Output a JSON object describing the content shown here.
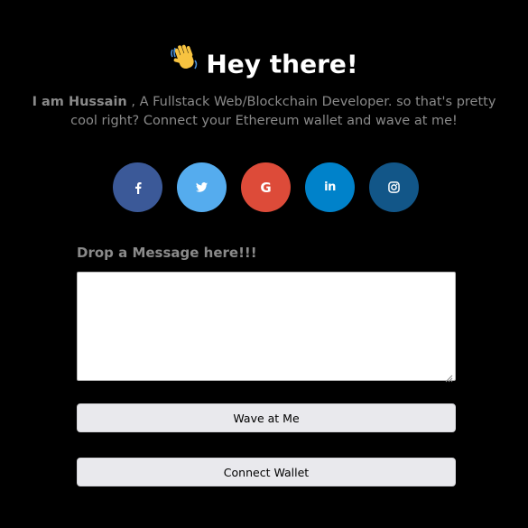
{
  "header": {
    "emoji_icon": "waving-hand-icon",
    "title": "Hey there!"
  },
  "bio": {
    "name": "I am Hussain",
    "text": ", A Fullstack Web/Blockchain Developer. so that's pretty cool right? Connect your Ethereum wallet and wave at me!"
  },
  "socials": [
    {
      "name": "facebook",
      "icon": "facebook-icon",
      "color": "#3b5998"
    },
    {
      "name": "twitter",
      "icon": "twitter-icon",
      "color": "#55acee"
    },
    {
      "name": "google",
      "icon": "google-icon",
      "color": "#dd4b39"
    },
    {
      "name": "linkedin",
      "icon": "linkedin-icon",
      "color": "#0082ca"
    },
    {
      "name": "instagram",
      "icon": "instagram-icon",
      "color": "#125688"
    }
  ],
  "message": {
    "label": "Drop a Message here!!!",
    "value": ""
  },
  "buttons": {
    "wave_label": "Wave at Me",
    "connect_label": "Connect Wallet"
  }
}
